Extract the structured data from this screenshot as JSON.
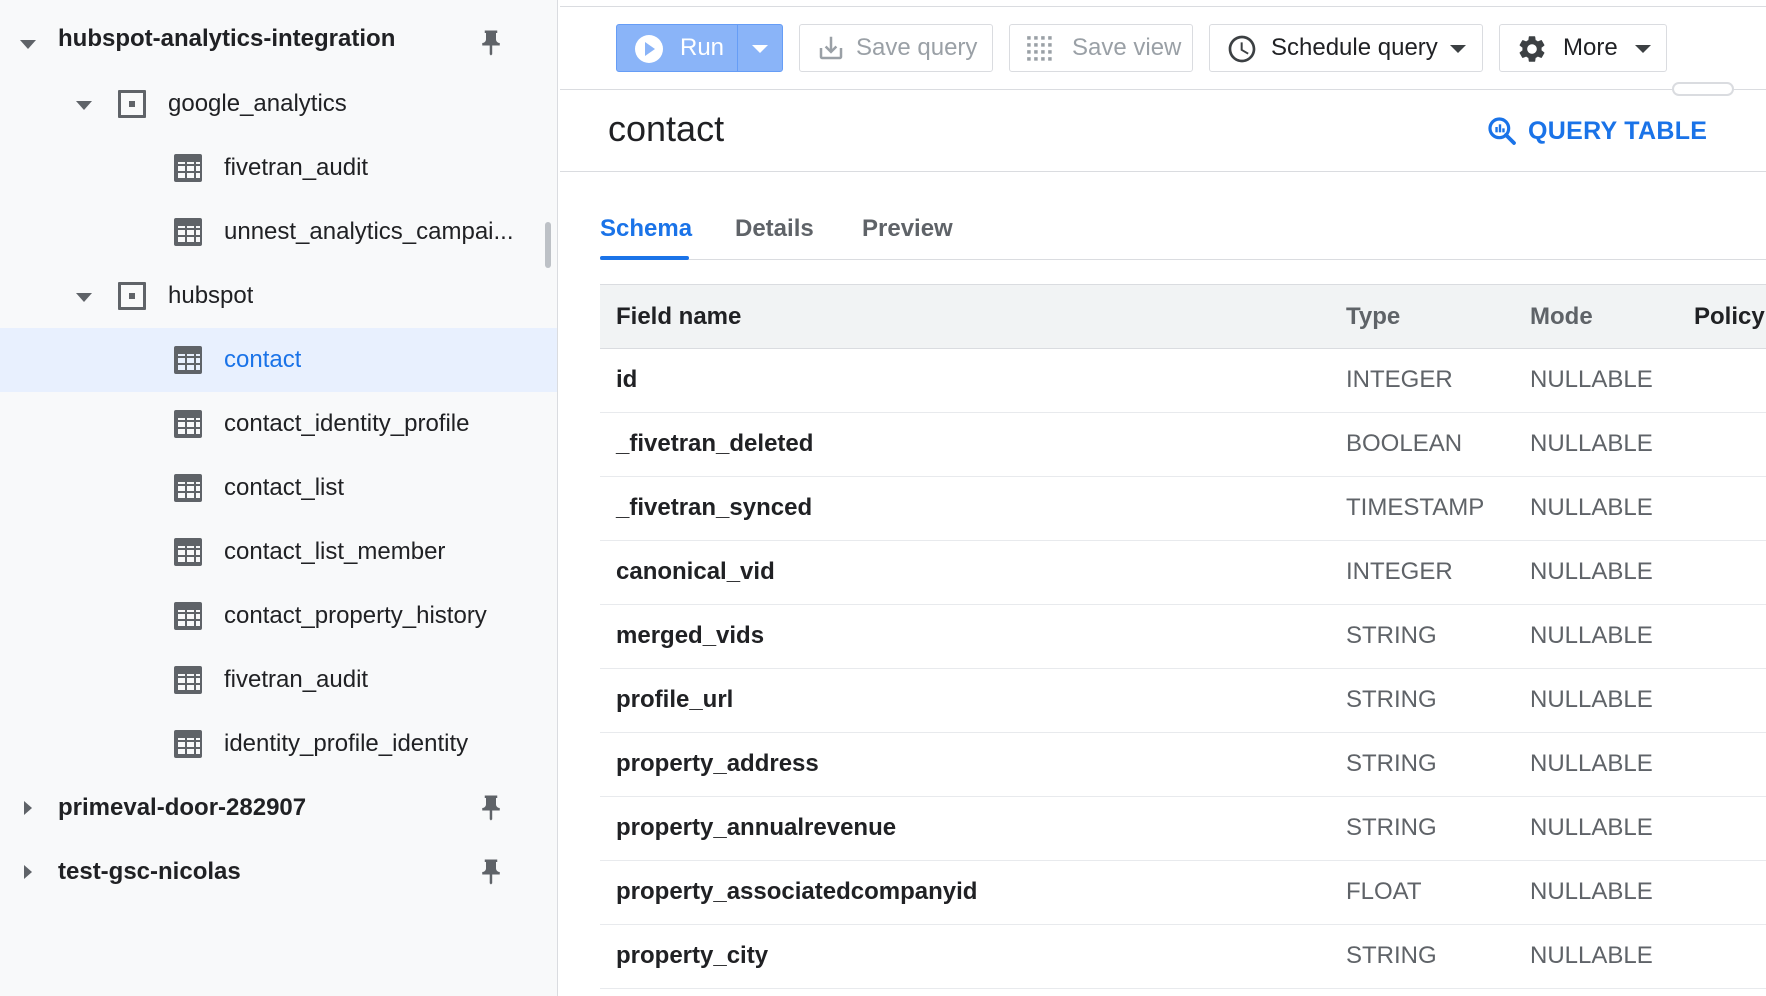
{
  "sidebar": {
    "items": [
      {
        "label": "hubspot-analytics-integration",
        "kind": "project",
        "expanded": true,
        "pinned": true
      },
      {
        "label": "google_analytics",
        "kind": "dataset",
        "expanded": true
      },
      {
        "label": "fivetran_audit",
        "kind": "table"
      },
      {
        "label": "unnest_analytics_campai...",
        "kind": "table"
      },
      {
        "label": "hubspot",
        "kind": "dataset",
        "expanded": true
      },
      {
        "label": "contact",
        "kind": "table",
        "selected": true
      },
      {
        "label": "contact_identity_profile",
        "kind": "table"
      },
      {
        "label": "contact_list",
        "kind": "table"
      },
      {
        "label": "contact_list_member",
        "kind": "table"
      },
      {
        "label": "contact_property_history",
        "kind": "table"
      },
      {
        "label": "fivetran_audit",
        "kind": "table"
      },
      {
        "label": "identity_profile_identity",
        "kind": "table"
      },
      {
        "label": "primeval-door-282907",
        "kind": "project",
        "expanded": false,
        "pinned": true
      },
      {
        "label": "test-gsc-nicolas",
        "kind": "project",
        "expanded": false,
        "pinned": true
      }
    ]
  },
  "toolbar": {
    "run_label": "Run",
    "save_query_label": "Save query",
    "save_view_label": "Save view",
    "schedule_query_label": "Schedule query",
    "more_label": "More"
  },
  "header": {
    "title": "contact",
    "query_table_label": "QUERY TABLE"
  },
  "tabs": [
    {
      "label": "Schema",
      "active": true
    },
    {
      "label": "Details",
      "active": false
    },
    {
      "label": "Preview",
      "active": false
    }
  ],
  "schema": {
    "columns": {
      "field": "Field name",
      "type": "Type",
      "mode": "Mode",
      "policy": "Policy t"
    },
    "rows": [
      {
        "field": "id",
        "type": "INTEGER",
        "mode": "NULLABLE"
      },
      {
        "field": "_fivetran_deleted",
        "type": "BOOLEAN",
        "mode": "NULLABLE"
      },
      {
        "field": "_fivetran_synced",
        "type": "TIMESTAMP",
        "mode": "NULLABLE"
      },
      {
        "field": "canonical_vid",
        "type": "INTEGER",
        "mode": "NULLABLE"
      },
      {
        "field": "merged_vids",
        "type": "STRING",
        "mode": "NULLABLE"
      },
      {
        "field": "profile_url",
        "type": "STRING",
        "mode": "NULLABLE"
      },
      {
        "field": "property_address",
        "type": "STRING",
        "mode": "NULLABLE"
      },
      {
        "field": "property_annualrevenue",
        "type": "STRING",
        "mode": "NULLABLE"
      },
      {
        "field": "property_associatedcompanyid",
        "type": "FLOAT",
        "mode": "NULLABLE"
      },
      {
        "field": "property_city",
        "type": "STRING",
        "mode": "NULLABLE"
      }
    ]
  },
  "icons": {
    "pin": "pin-icon",
    "dataset": "dataset-icon",
    "table": "table-icon",
    "run": "play-circle-icon",
    "save_query": "download-icon",
    "save_view": "grid-dots-icon",
    "schedule": "clock-icon",
    "more": "gear-icon",
    "query_table": "search-chart-icon"
  },
  "colors": {
    "accent": "#1a73e8",
    "run_button": "#8ab4f8",
    "selected_row": "#e8f0fe",
    "sidebar_bg": "#f8f9fa"
  }
}
